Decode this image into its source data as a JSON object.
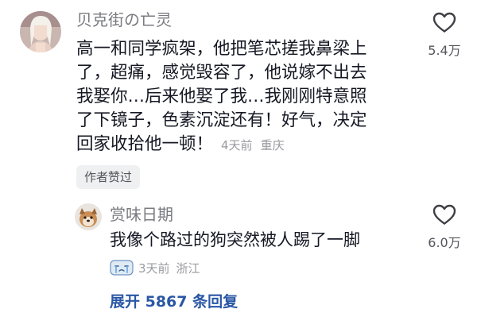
{
  "comment": {
    "username": "贝克街の亡灵",
    "lines": [
      "高一和同学疯架，他把笔芯搓我鼻梁上",
      "了，超痛，感觉毁容了，他说嫁不出去",
      "我娶你…后来他娶了我…我刚刚特意照",
      "了下镜子，色素沉淀还有！好气，决定",
      "回家收拾他一顿！"
    ],
    "time": "4天前",
    "location": "重庆",
    "like_count": "5.4万",
    "author_badge": "作者赞过"
  },
  "reply": {
    "username": "赏味日期",
    "text": "我像个路过的狗突然被人踢了一脚",
    "time": "3天前",
    "location": "浙江",
    "like_count": "6.0万"
  },
  "expand_label": "展开 5867 条回复",
  "colors": {
    "link_blue": "#2a57a5",
    "secondary_gray": "#9a9ba0"
  }
}
